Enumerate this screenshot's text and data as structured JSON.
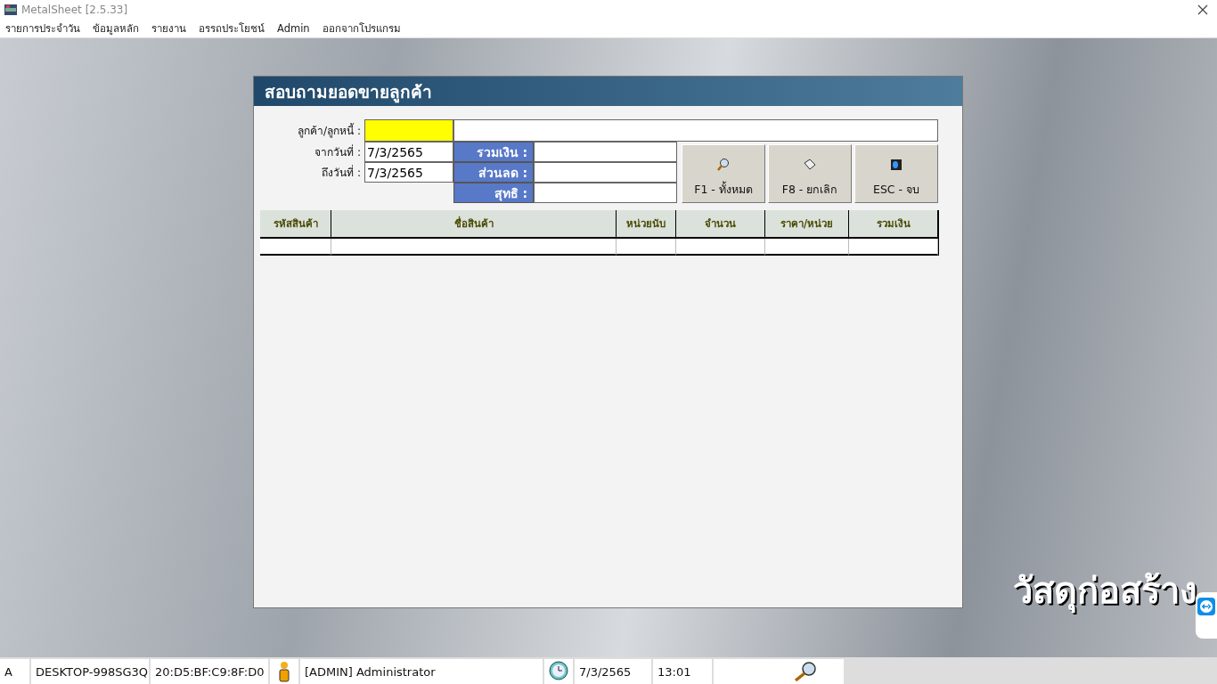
{
  "window": {
    "title": "MetalSheet [2.5.33]"
  },
  "menu": [
    "รายการประจำวัน",
    "ข้อมูลหลัก",
    "รายงาน",
    "อรรถประโยชน์",
    "Admin",
    "ออกจากโปรแกรม"
  ],
  "dialog": {
    "title": "สอบถามยอดขายลูกค้า",
    "customer": {
      "label": "ลูกค้า/ลูกหนี้ :"
    },
    "date_from": {
      "label": "จากวันที่ :",
      "value": "7/3/2565"
    },
    "date_to": {
      "label": "ถึงวันที่ :",
      "value": "7/3/2565"
    },
    "totals": [
      {
        "label": "รวมเงิน :"
      },
      {
        "label": "ส่วนลด :"
      },
      {
        "label": "สุทธิ :"
      }
    ],
    "buttons": [
      {
        "label": "F1 - ทั้งหมด",
        "kind": "all"
      },
      {
        "label": "F8 - ยกเลิก",
        "kind": "cancel"
      },
      {
        "label": "ESC - จบ",
        "kind": "exit"
      }
    ],
    "table": {
      "columns": [
        "รหัสสินค้า",
        "ชื่อสินค้า",
        "หน่วยนับ",
        "จำนวน",
        "ราคา/หน่วย",
        "รวมเงิน"
      ]
    }
  },
  "background_text": "วัสดุก่อสร้าง",
  "status_bar": [
    {
      "kind": "text",
      "text": "A"
    },
    {
      "kind": "text",
      "text": "DESKTOP-998SG3Q"
    },
    {
      "kind": "text",
      "text": "20:D5:BF:C9:8F:D0"
    },
    {
      "kind": "user"
    },
    {
      "kind": "text",
      "text": "[ADMIN] Administrator"
    },
    {
      "kind": "clock"
    },
    {
      "kind": "text",
      "text": "7/3/2565"
    },
    {
      "kind": "text",
      "text": "13:01"
    },
    {
      "kind": "search"
    }
  ]
}
